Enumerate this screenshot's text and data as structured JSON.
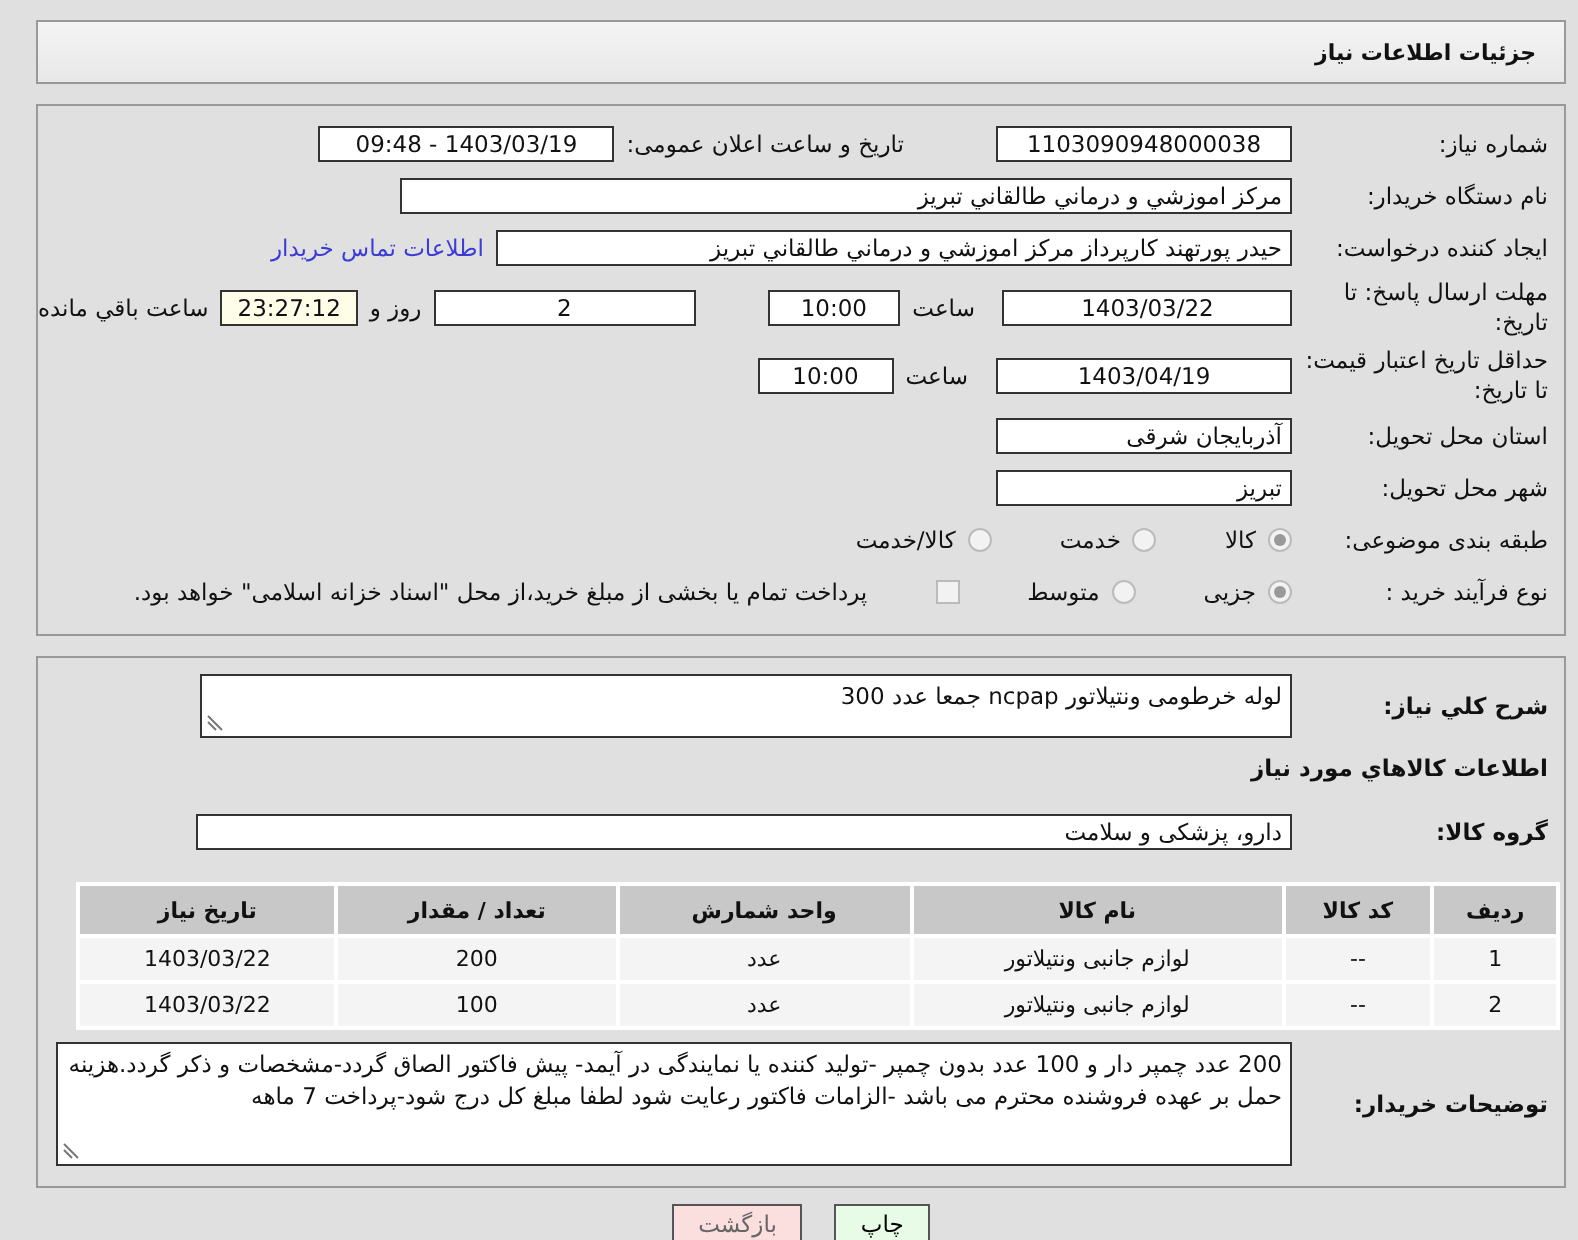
{
  "header": {
    "title": "جزئیات اطلاعات نیاز"
  },
  "need_number": {
    "label": "شماره نیاز:",
    "value": "1103090948000038"
  },
  "announce": {
    "label": "تاریخ و ساعت اعلان عمومی:",
    "value": "1403/03/19 - 09:48"
  },
  "buyer_org": {
    "label": "نام دستگاه خریدار:",
    "value": "مرکز اموزشي و درماني طالقاني تبريز"
  },
  "requester": {
    "label": "ایجاد کننده درخواست:",
    "value": "حیدر پورتهند کارپرداز مرکز اموزشي و درماني طالقاني تبريز",
    "link": "اطلاعات تماس خریدار"
  },
  "deadline": {
    "label": "مهلت ارسال پاسخ: تا تاریخ:",
    "date": "1403/03/22",
    "time_label": "ساعت",
    "time": "10:00",
    "days": "2",
    "days_label": "روز و",
    "remaining": "23:27:12",
    "remaining_label": "ساعت باقي مانده"
  },
  "validity": {
    "label": "حداقل تاریخ اعتبار قیمت: تا تاریخ:",
    "date": "1403/04/19",
    "time_label": "ساعت",
    "time": "10:00"
  },
  "province": {
    "label": "استان محل تحویل:",
    "value": "آذربایجان شرقی"
  },
  "city": {
    "label": "شهر محل تحویل:",
    "value": "تبریز"
  },
  "category": {
    "label": "طبقه بندی موضوعی:",
    "options": [
      {
        "label": "کالا",
        "selected": true
      },
      {
        "label": "خدمت",
        "selected": false
      },
      {
        "label": "کالا/خدمت",
        "selected": false
      }
    ]
  },
  "process": {
    "label": "نوع فرآیند خرید :",
    "options": [
      {
        "label": "جزیی",
        "selected": true
      },
      {
        "label": "متوسط",
        "selected": false
      }
    ],
    "treasury": {
      "label": "پرداخت تمام یا بخشی از مبلغ خرید،از محل \"اسناد خزانه اسلامی\" خواهد بود.",
      "checked": false
    }
  },
  "description": {
    "label": "شرح کلي نیاز:",
    "value": "لوله خرطومی ونتیلاتور ncpap  جمعا  عدد 300"
  },
  "goods_heading": "اطلاعات کالاهاي مورد نياز",
  "goods_group": {
    "label": "گروه کالا:",
    "value": "دارو، پزشکی و سلامت"
  },
  "table": {
    "columns": [
      "ردیف",
      "کد کالا",
      "نام کالا",
      "واحد شمارش",
      "تعداد / مقدار",
      "تاریخ نیاز"
    ],
    "rows": [
      [
        "1",
        "--",
        "لوازم جانبی ونتیلاتور",
        "عدد",
        "200",
        "1403/03/22"
      ],
      [
        "2",
        "--",
        "لوازم جانبی ونتیلاتور",
        "عدد",
        "100",
        "1403/03/22"
      ]
    ]
  },
  "buyer_notes": {
    "label": "توضیحات خریدار:",
    "value": "200 عدد چمپر دار و 100 عدد بدون چمپر -تولید کننده یا نمایندگی در آیمد- پیش فاکتور الصاق گردد-مشخصات و ذکر گردد.هزینه حمل بر عهده فروشنده محترم می باشد -الزامات فاکتور رعایت شود لطفا مبلغ کل درج شود-پرداخت 7 ماهه"
  },
  "buttons": [
    {
      "label": "چاپ",
      "kind": "print"
    },
    {
      "label": "بازگشت",
      "kind": "back"
    }
  ]
}
